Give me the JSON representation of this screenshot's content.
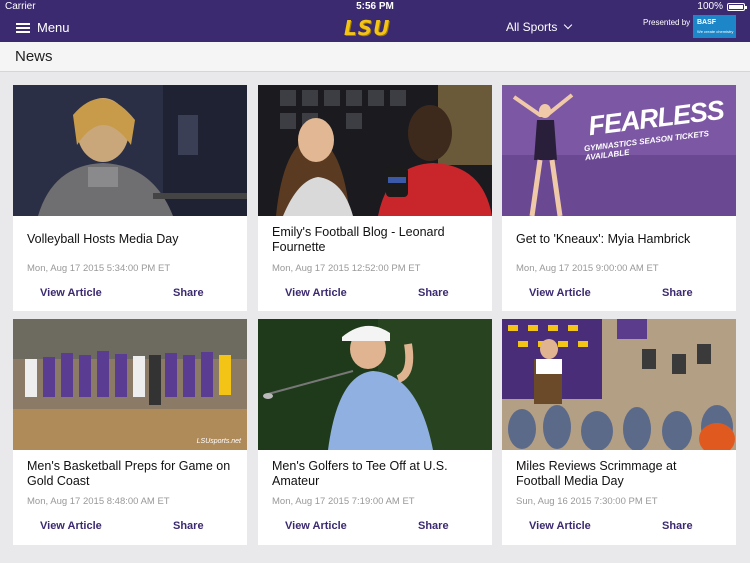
{
  "statusbar": {
    "carrier": "Carrier",
    "time": "5:56 PM",
    "battery": "100%"
  },
  "navbar": {
    "menu_label": "Menu",
    "logo": "LSU",
    "sports_dropdown": "All Sports",
    "presented_by": "Presented by",
    "sponsor_name": "BASF",
    "sponsor_tagline": "We create chemistry"
  },
  "page_title": "News",
  "colors": {
    "primary": "#3c2a70",
    "gold": "#f3c316",
    "background": "#e9e9eb"
  },
  "articles": [
    {
      "title": "Volleyball Hosts Media Day",
      "date": "Mon, Aug 17 2015 5:34:00 PM ET",
      "view_label": "View Article",
      "share_label": "Share"
    },
    {
      "title": "Emily's Football Blog - Leonard Fournette",
      "date": "Mon, Aug 17 2015 12:52:00 PM ET",
      "view_label": "View Article",
      "share_label": "Share"
    },
    {
      "title": "Get to 'Kneaux': Myia Hambrick",
      "date": "Mon, Aug 17 2015 9:00:00 AM ET",
      "view_label": "View Article",
      "share_label": "Share",
      "overlay_title": "FEARLESS",
      "overlay_subtitle": "GYMNASTICS SEASON TICKETS AVAILABLE"
    },
    {
      "title": "Men's Basketball Preps for Game on Gold Coast",
      "date": "Mon, Aug 17 2015 8:48:00 AM ET",
      "view_label": "View Article",
      "share_label": "Share",
      "watermark": "LSUsports.net"
    },
    {
      "title": "Men's Golfers to Tee Off at U.S. Amateur",
      "date": "Mon, Aug 17 2015 7:19:00 AM ET",
      "view_label": "View Article",
      "share_label": "Share"
    },
    {
      "title": "Miles Reviews Scrimmage at Football Media Day",
      "date": "Sun, Aug 16 2015 7:30:00 PM ET",
      "view_label": "View Article",
      "share_label": "Share"
    }
  ]
}
